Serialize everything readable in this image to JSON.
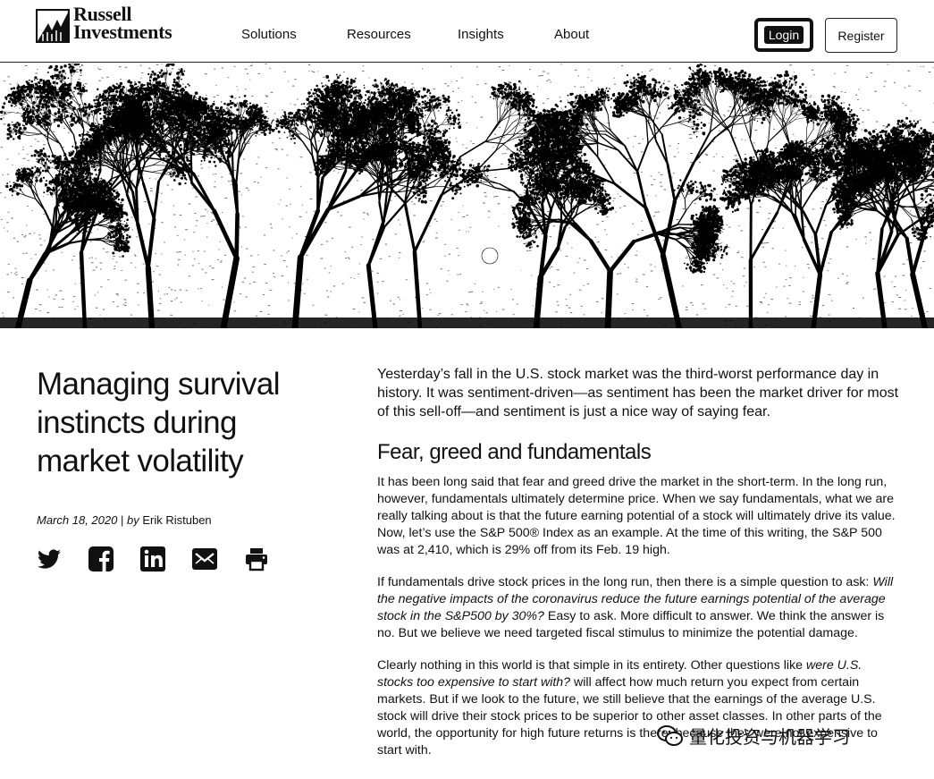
{
  "brand": {
    "line1": "Russell",
    "line2": "Investments"
  },
  "nav": {
    "items": [
      "Solutions",
      "Resources",
      "Insights",
      "About"
    ]
  },
  "header": {
    "login_label": "Login",
    "register_label": "Register"
  },
  "hero": {
    "icon": "trees-sunburst-photo"
  },
  "article": {
    "title": "Managing survival instincts during market volatility",
    "date": "March 18, 2020",
    "separator": "|",
    "by": "by",
    "author": "Erik Ristuben",
    "share_icons": [
      "twitter-icon",
      "facebook-icon",
      "linkedin-icon",
      "email-icon",
      "print-icon"
    ],
    "lead": "Yesterday’s fall in the U.S. stock market was the third-worst performance day in history. It was sentiment-driven—as sentiment has been the market driver for most of this sell-off—and sentiment is just a nice way of saying fear.",
    "section_heading": "Fear, greed and fundamentals",
    "p1": "It has been long said that fear and greed drive the market in the short-term. In the long run, however, fundamentals ultimately determine price. When we say fundamentals, what we are really talking about is that the future earning potential of a stock will ultimately drive its value. Now, let’s use the S&P 500® Index as an example. At the time of this writing, the S&P 500 was at 2,410, which is 29% off from its Feb. 19 high.",
    "p2_before": "If fundamentals drive stock prices in the long run, then there is a simple question to ask: ",
    "p2_italic": "Will the negative impacts of the coronavirus reduce the future earnings potential of the average stock in the S&P500 by 30%?",
    "p2_after": "  Easy to ask. More difficult to answer. We think the answer is no. But we believe we need targeted fiscal stimulus to minimize the potential damage.",
    "p3_before": "Clearly nothing in this world is that simple in its entirety. Other questions like ",
    "p3_italic": "were U.S. stocks too expensive to start with?",
    "p3_after": " will affect how much return you expect from certain markets. But if we look to the future, we still believe that the earnings of the average U.S. stock will drive their stock prices to be superior to other asset classes.  In other parts of the world, the opportunity for high future returns is there, because they were not expensive to start with."
  },
  "watermark": {
    "text": "量化投资与机器学习",
    "icon": "wechat-icon"
  }
}
